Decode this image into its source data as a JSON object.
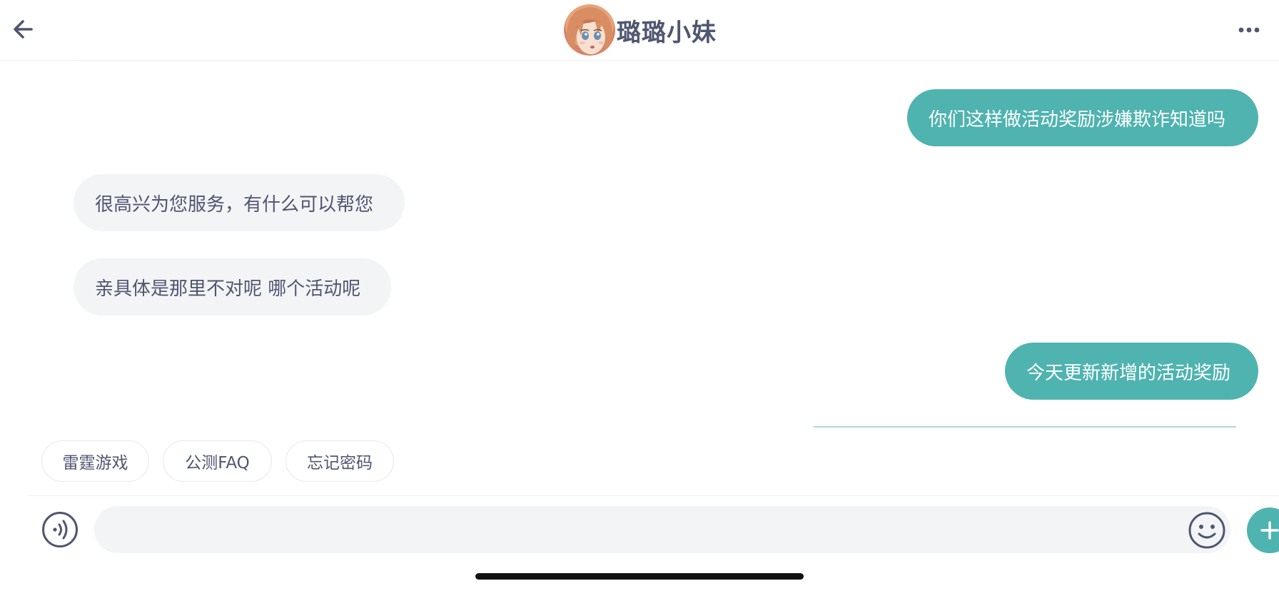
{
  "header": {
    "title": "璐璐小妹",
    "back_icon": "arrow-left-icon",
    "more_icon": "more-horizontal-icon",
    "avatar": "anime-girl-avatar"
  },
  "messages": [
    {
      "side": "out",
      "text": "你们这样做活动奖励涉嫌欺诈知道吗"
    },
    {
      "side": "in",
      "text": "很高兴为您服务，有什么可以帮您"
    },
    {
      "side": "in",
      "text": "亲具体是那里不对呢 哪个活动呢"
    },
    {
      "side": "out",
      "text": "今天更新新增的活动奖励"
    }
  ],
  "quick_replies": [
    "雷霆游戏",
    "公测FAQ",
    "忘记密码"
  ],
  "input": {
    "value": "",
    "placeholder": "",
    "voice_icon": "voice-icon",
    "emoji_icon": "smiley-icon",
    "plus_icon": "plus-icon"
  },
  "colors": {
    "accent": "#4fb3b0",
    "incoming_bubble": "#f3f4f6",
    "text": "#4f5670",
    "background": "#ffffff"
  }
}
